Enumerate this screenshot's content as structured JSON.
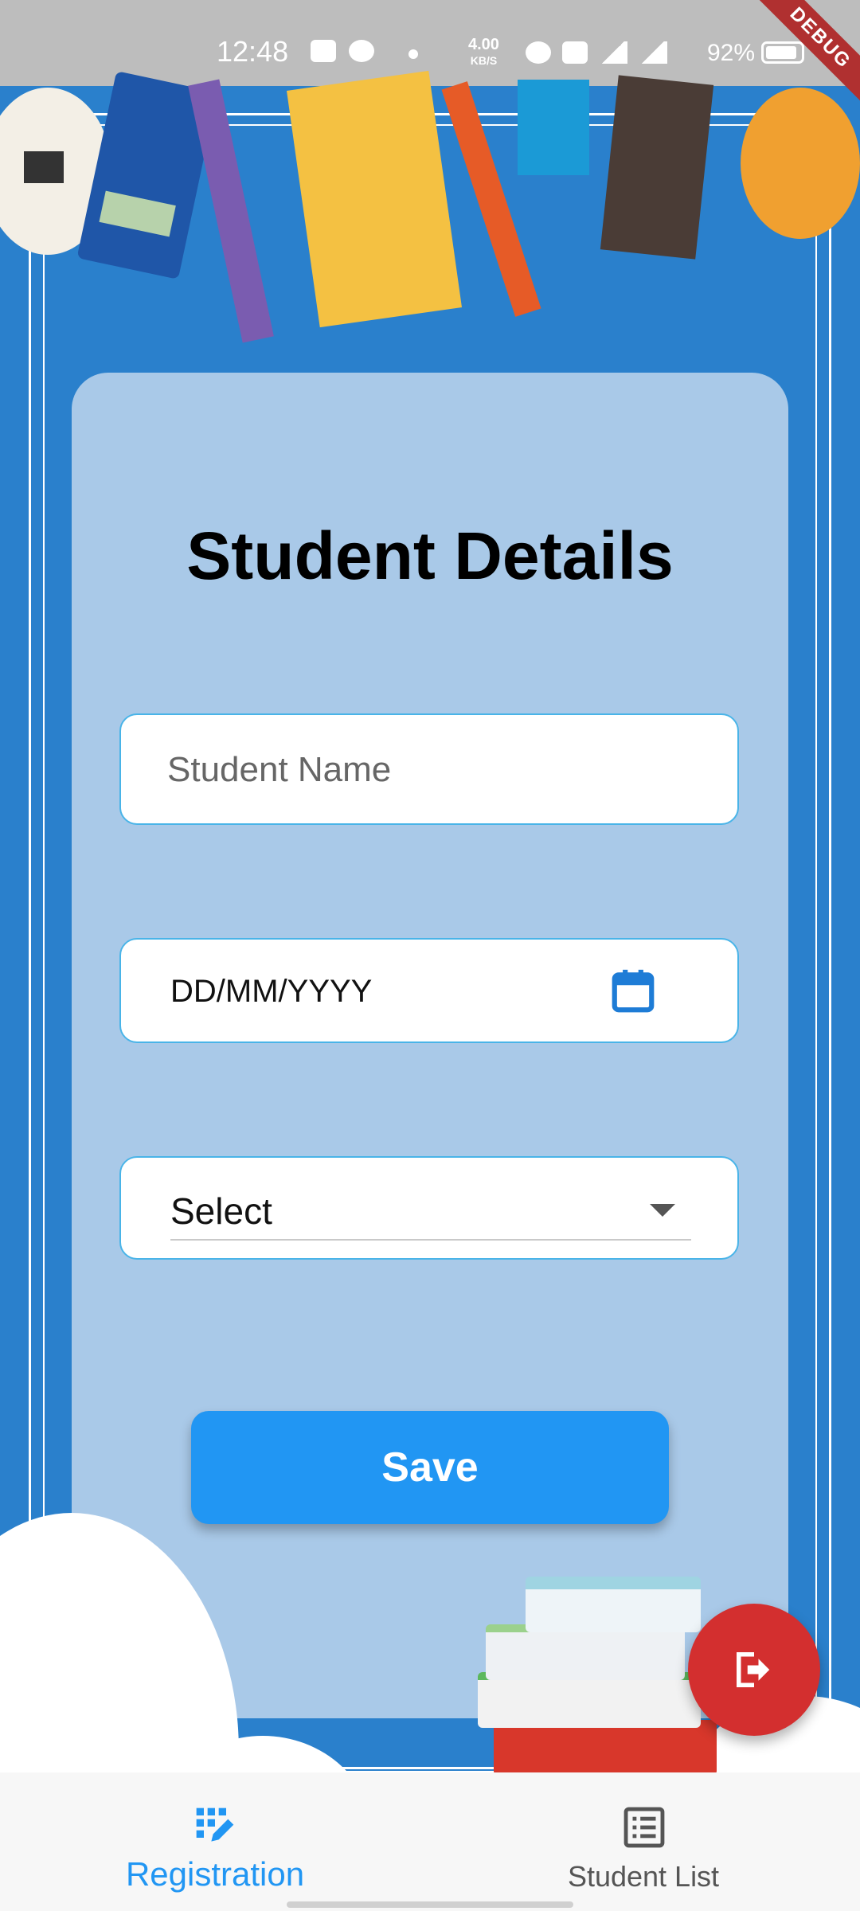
{
  "status_bar": {
    "time": "12:48",
    "network_speed_value": "4.00",
    "network_speed_unit": "KB/S",
    "battery": "92%",
    "debug_banner": "DEBUG"
  },
  "form": {
    "title": "Student Details",
    "name_placeholder": "Student Name",
    "date_text": "DD/MM/YYYY",
    "select_text": "Select",
    "save_label": "Save"
  },
  "bottom_nav": {
    "items": [
      {
        "label": "Registration",
        "icon": "edit-grid-icon",
        "active": true
      },
      {
        "label": "Student List",
        "icon": "list-icon",
        "active": false
      }
    ]
  },
  "colors": {
    "primary": "#2196f3",
    "fab": "#d32f2f",
    "background": "#2a80cc",
    "card": "#a9c9e8"
  },
  "icons": {
    "date_field": "calendar-icon",
    "select_field": "caret-down-icon",
    "fab": "logout-icon"
  }
}
